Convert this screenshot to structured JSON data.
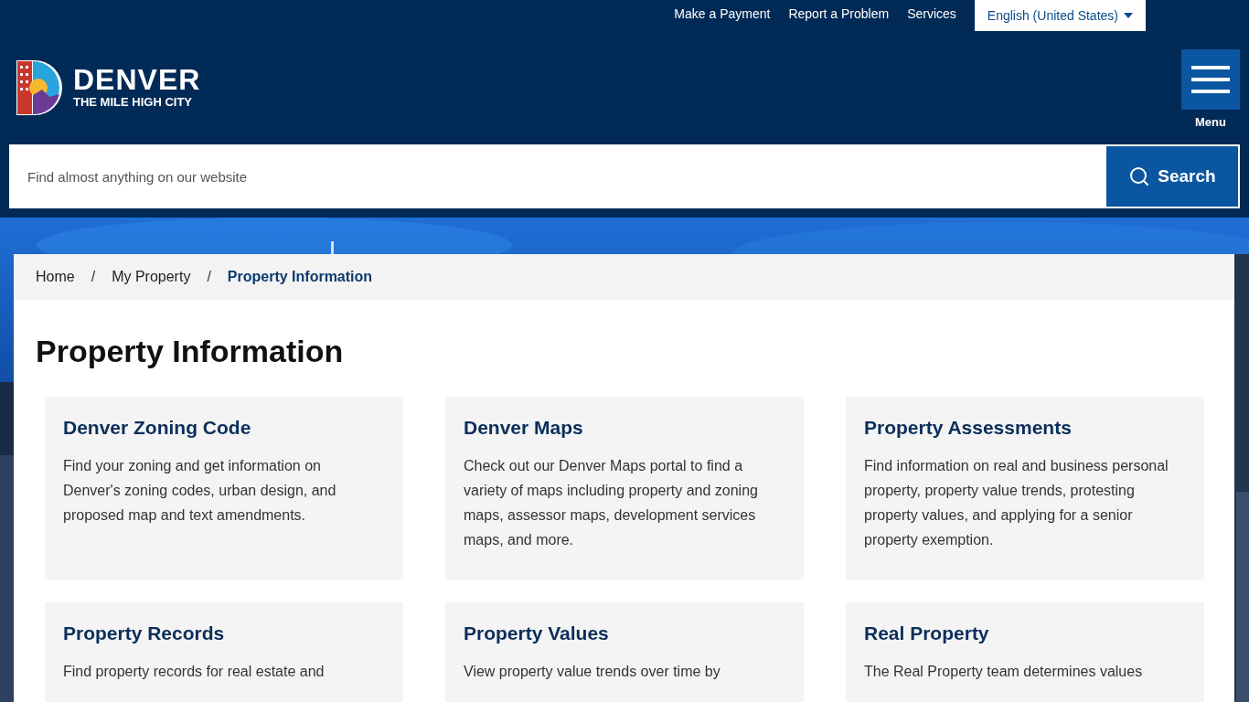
{
  "utility_links": [
    "Make a Payment",
    "Report a Problem",
    "Services"
  ],
  "language": {
    "value": "English (United States)"
  },
  "logo": {
    "name": "DENVER",
    "tagline": "THE MILE HIGH CITY"
  },
  "menu": {
    "label": "Menu"
  },
  "search": {
    "placeholder": "Find almost anything on our website",
    "button": "Search"
  },
  "breadcrumb": [
    {
      "label": "Home",
      "current": false
    },
    {
      "label": "My Property",
      "current": false
    },
    {
      "label": "Property Information",
      "current": true
    }
  ],
  "breadcrumb_separator": "/",
  "page_title": "Property Information",
  "cards": [
    {
      "title": "Denver Zoning Code",
      "text": "Find your zoning and get information on Denver's zoning codes, urban design, and proposed map and text amendments."
    },
    {
      "title": "Denver Maps",
      "text": "Check out our Denver Maps portal to find a variety of maps including property and zoning maps, assessor maps, development services maps, and more."
    },
    {
      "title": "Property Assessments",
      "text": "Find information on real and business personal property, property value trends, protesting property values, and applying for a senior property exemption."
    },
    {
      "title": "Property Records",
      "text": "Find property records for real estate and"
    },
    {
      "title": "Property Values",
      "text": "View property value trends over time by"
    },
    {
      "title": "Real Property",
      "text": "The Real Property team determines values"
    }
  ]
}
